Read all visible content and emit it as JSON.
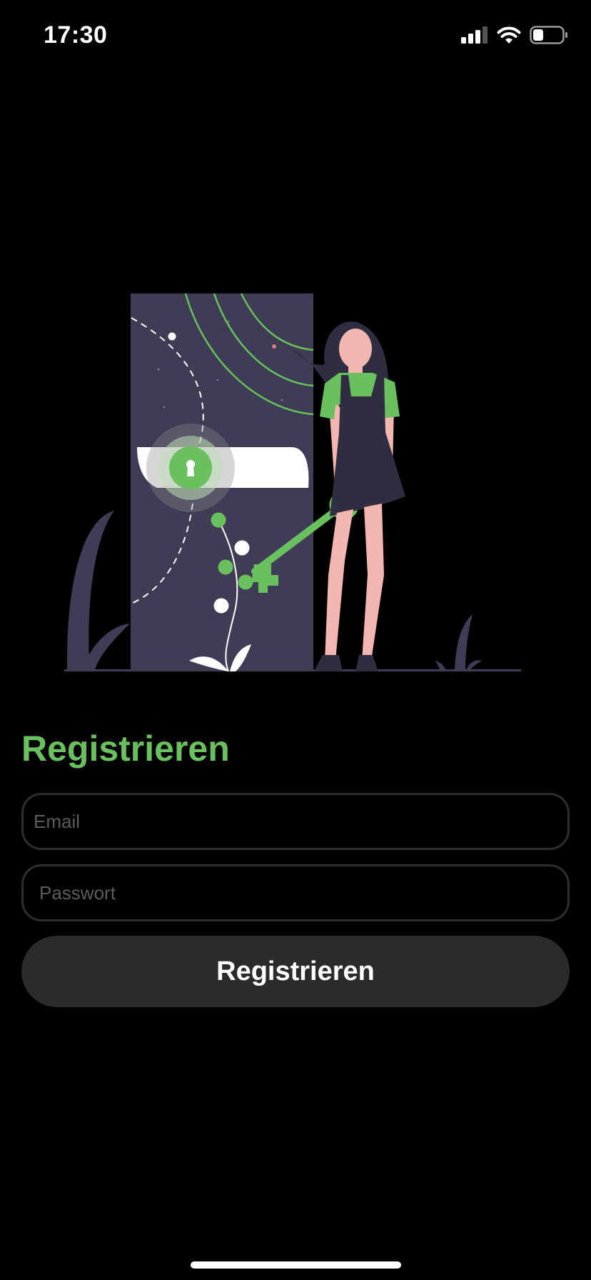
{
  "status_bar": {
    "time": "17:30",
    "icons": [
      "cellular-signal-icon",
      "wifi-icon",
      "battery-icon"
    ],
    "battery_level": 0.35
  },
  "illustration": {
    "name": "login-illustration",
    "colors": {
      "accent": "#6abf5e",
      "door": "#3f3d56",
      "skin": "#f4b6b0",
      "hair": "#2f2e41"
    }
  },
  "form": {
    "title": "Registrieren",
    "email_placeholder": "Email",
    "password_placeholder": "Passwort",
    "submit_label": "Registrieren"
  },
  "theme": {
    "accent": "#6abf5e",
    "background": "#000000",
    "field_border": "#2e2e2e",
    "button_bg": "#2b2b2b"
  }
}
